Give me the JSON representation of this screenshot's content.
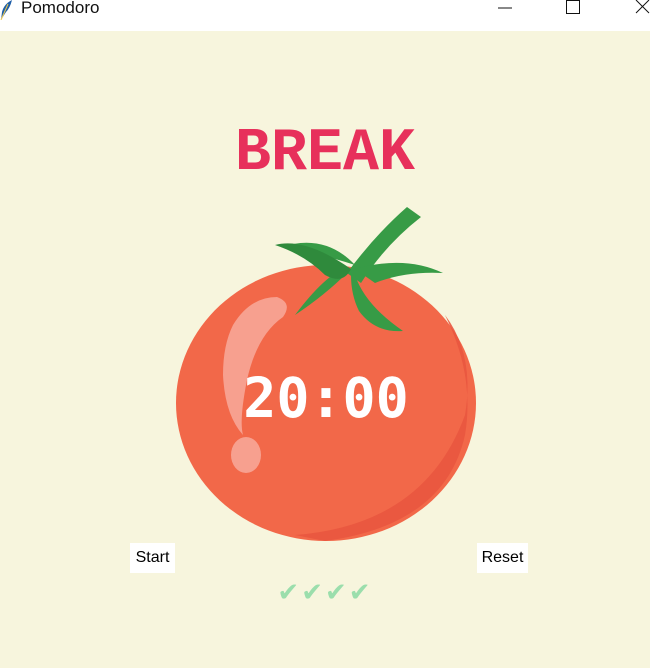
{
  "window": {
    "title": "Pomodoro",
    "controls": [
      "minimize-icon",
      "maximize-icon",
      "close-icon"
    ]
  },
  "header": {
    "label": "BREAK",
    "color": "#e7305b"
  },
  "timer": {
    "display": "20:00"
  },
  "buttons": {
    "start_label": "Start",
    "reset_label": "Reset"
  },
  "progress": {
    "checkmarks": "✔✔✔✔",
    "completed_count": 4,
    "color": "#9bdeac"
  },
  "colors": {
    "background": "#f7f5dd",
    "tomato": "#f26849",
    "stem": "#379b46"
  }
}
